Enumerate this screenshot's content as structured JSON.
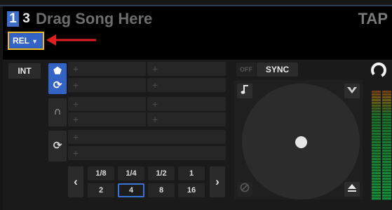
{
  "header": {
    "deck_number": "1",
    "deck_secondary": "3",
    "song_placeholder": "Drag Song Here",
    "tap_label": "TAP",
    "mode_button": "REL",
    "mode_caret": "▼"
  },
  "annotation": {
    "arrow_color": "#e02020",
    "highlight_color": "#f2b81f"
  },
  "left_controls": {
    "int_label": "INT"
  },
  "side_buttons": [
    {
      "icon": "cue-icon",
      "glyph": "⬟",
      "active": true
    },
    {
      "icon": "sync-loop-icon",
      "glyph": "⟳",
      "active": true
    },
    {
      "icon": "headphones-icon",
      "glyph": "∩",
      "active": false
    },
    {
      "icon": "loop-icon",
      "glyph": "⟳",
      "active": false
    }
  ],
  "pads": {
    "plus_glyph": "+"
  },
  "loop": {
    "prev": "‹",
    "next": "›",
    "row1": [
      "1/8",
      "1/4",
      "1/2",
      "1"
    ],
    "row2": [
      "2",
      "4",
      "8",
      "16"
    ],
    "active": "4"
  },
  "sync_controls": {
    "off_label": "OFF",
    "sync_label": "SYNC"
  },
  "colors": {
    "accent": "#3363c4",
    "background": "#161616",
    "header_bg": "#000000"
  }
}
